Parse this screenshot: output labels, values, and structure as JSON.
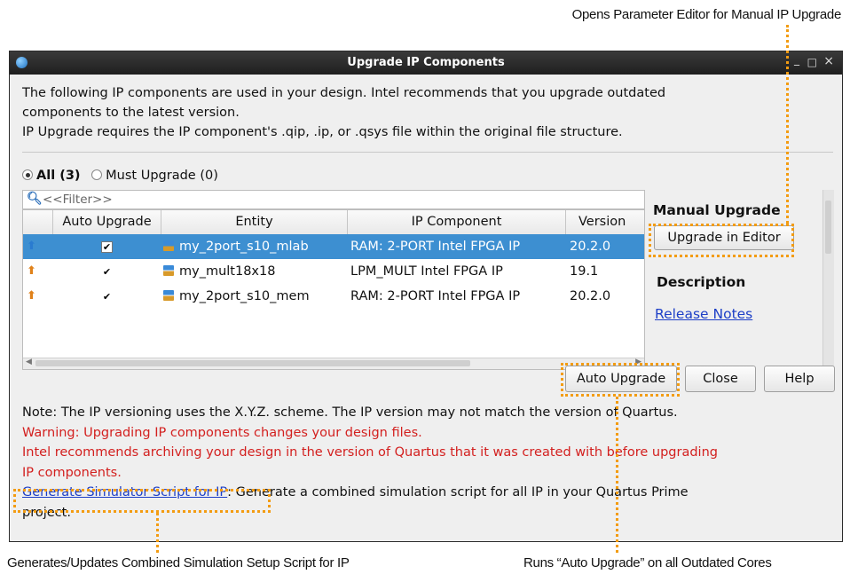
{
  "callouts": {
    "top": "Opens Parameter Editor for Manual IP Upgrade",
    "bottom_left": "Generates/Updates Combined Simulation Setup Script for IP",
    "bottom_right": "Runs “Auto Upgrade” on all Outdated Cores"
  },
  "window": {
    "title": "Upgrade IP Components",
    "controls": {
      "minimize": "_",
      "maximize": "□",
      "close": "×"
    }
  },
  "intro": {
    "line1": "The following IP components are used in your design. Intel recommends that you upgrade outdated",
    "line2": "components to the latest version.",
    "line3": "IP Upgrade requires the IP component's .qip, .ip, or .qsys file within the original file structure."
  },
  "filter_options": {
    "all_label": "All (3)",
    "must_label": "Must Upgrade (0)",
    "selected": "All (3)"
  },
  "filter": {
    "placeholder": "<<Filter>>"
  },
  "table": {
    "columns": [
      "",
      "Auto Upgrade",
      "Entity",
      "IP Component",
      "Version"
    ],
    "rows": [
      {
        "auto_upgrade": "✔",
        "entity": "my_2port_s10_mlab",
        "ip_component": "RAM: 2-PORT Intel FPGA IP",
        "version": "20.2.0",
        "selected": true
      },
      {
        "auto_upgrade": "✔",
        "entity": "my_mult18x18",
        "ip_component": "LPM_MULT Intel FPGA IP",
        "version": "19.1",
        "selected": false
      },
      {
        "auto_upgrade": "✔",
        "entity": "my_2port_s10_mem",
        "ip_component": "RAM: 2-PORT Intel FPGA IP",
        "version": "20.2.0",
        "selected": false
      }
    ]
  },
  "side_panel": {
    "manual_upgrade": "Manual Upgrade",
    "upgrade_in_editor": "Upgrade in Editor",
    "description": "Description",
    "release_notes": "Release Notes"
  },
  "buttons": {
    "auto_upgrade": "Auto Upgrade",
    "close": "Close",
    "help": "Help"
  },
  "notes": {
    "note": "Note: The IP versioning uses the X.Y.Z. scheme. The IP version may not match the version of Quartus.",
    "warning1": "Warning: Upgrading IP components changes your design files.",
    "warning2a": "Intel recommends archiving your design in the version of Quartus that it was created with before upgrading",
    "warning2b": "IP components.",
    "sim_link": "Generate Simulator Script for IP",
    "sim_text_a": ": Generate a combined simulation script for all IP in your Quartus Prime",
    "sim_text_b": "project."
  },
  "colors": {
    "highlight": "#f39c12",
    "selection": "#3d8fd1",
    "warning": "#d3201f",
    "link": "#1d3fc7"
  }
}
